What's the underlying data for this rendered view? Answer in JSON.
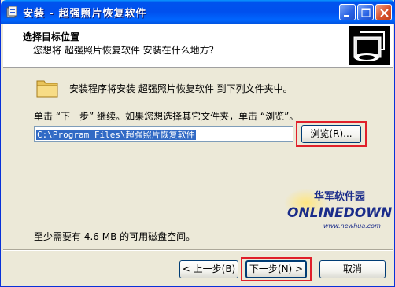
{
  "window": {
    "title": "安装 - 超强照片恢复软件",
    "controls": {
      "minimize": "minimize",
      "maximize": "maximize",
      "close": "close"
    }
  },
  "header": {
    "title": "选择目标位置",
    "subtitle": "您想将 超强照片恢复软件 安装在什么地方？"
  },
  "body": {
    "install_line": "安装程序将安装 超强照片恢复软件 到下列文件夹中。",
    "instruction": "单击 “下一步” 继续。如果您想选择其它文件夹，单击 “浏览”。",
    "path_value": "C:\\Program Files\\超强照片恢复软件",
    "browse_label": "浏览(R)...",
    "space_required": "至少需要有 4.6 MB 的可用磁盘空间。"
  },
  "watermark": {
    "cn": "华军软件园",
    "brand": "ONLINEDOWN",
    "url": "www.newhua.com"
  },
  "footer": {
    "back_label": "< 上一步(B)",
    "next_label": "下一步(N) >",
    "cancel_label": "取消"
  },
  "colors": {
    "titlebar": "#0053ee",
    "highlight": "#e0202a",
    "selection": "#316ac5"
  }
}
